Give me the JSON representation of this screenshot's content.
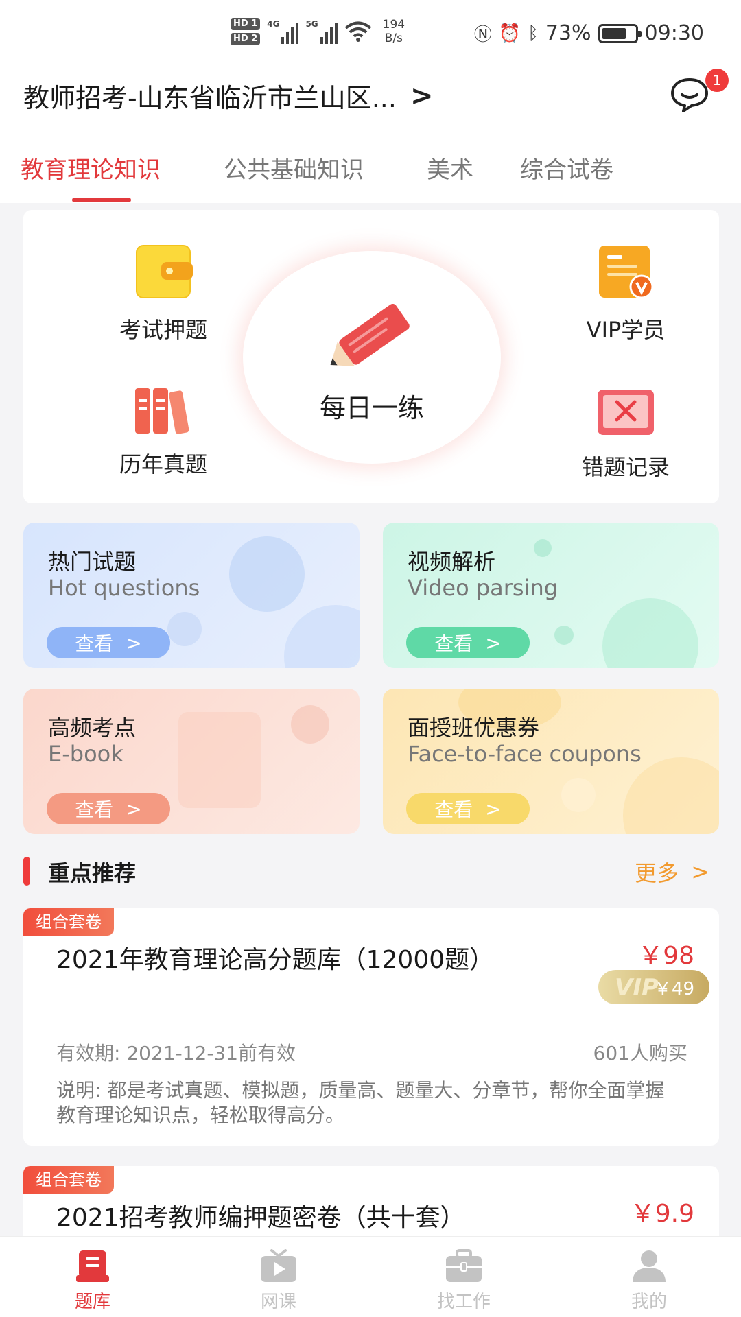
{
  "status_bar": {
    "hd1": "HD 1",
    "hd2": "HD 2",
    "net1": "4G",
    "net2": "5G",
    "speed_value": "194",
    "speed_unit": "B/s",
    "battery": "73%",
    "battery_level": 0.73,
    "time": "09:30"
  },
  "header": {
    "location": "教师招考-山东省临沂市兰山区...",
    "message_badge": "1"
  },
  "tabs": [
    {
      "label": "教育理论知识",
      "active": true
    },
    {
      "label": "公共基础知识",
      "active": false
    },
    {
      "label": "美术",
      "active": false
    },
    {
      "label": "综合试卷",
      "active": false
    }
  ],
  "grid": {
    "exam_predict": "考试押题",
    "vip_member": "VIP学员",
    "past_papers": "历年真题",
    "wrong_records": "错题记录",
    "daily_practice": "每日一练"
  },
  "features": [
    {
      "title": "热门试题",
      "subtitle": "Hot questions",
      "button": "查看"
    },
    {
      "title": "视频解析",
      "subtitle": "Video parsing",
      "button": "查看"
    },
    {
      "title": "高频考点",
      "subtitle": "E-book",
      "button": "查看"
    },
    {
      "title": "面授班优惠券",
      "subtitle": "Face-to-face coupons",
      "button": "查看"
    }
  ],
  "section": {
    "title": "重点推荐",
    "more": "更多"
  },
  "products": [
    {
      "tag": "组合套卷",
      "title": "2021年教育理论高分题库（12000题）",
      "price": "￥98",
      "vip_price": "￥49",
      "vip_mark": "VIP",
      "validity": "有效期: 2021-12-31前有效",
      "buyers": "601人购买",
      "description": "说明: 都是考试真题、模拟题，质量高、题量大、分章节，帮你全面掌握教育理论知识点，轻松取得高分。"
    },
    {
      "tag": "组合套卷",
      "title": "2021招考教师编押题密卷（共十套）",
      "price": "￥9.9"
    }
  ],
  "bottom_nav": [
    {
      "label": "题库",
      "icon": "question-bank-icon",
      "active": true
    },
    {
      "label": "网课",
      "icon": "tv-icon",
      "active": false
    },
    {
      "label": "找工作",
      "icon": "briefcase-icon",
      "active": false
    },
    {
      "label": "我的",
      "icon": "person-icon",
      "active": false
    }
  ],
  "colors": {
    "accent": "#e2393c",
    "more": "#f29a2e",
    "blue_btn": "#8fb4f7",
    "green_btn": "#5fd9a6",
    "orange_btn": "#f49a82",
    "yellow_btn": "#f8d96a"
  }
}
